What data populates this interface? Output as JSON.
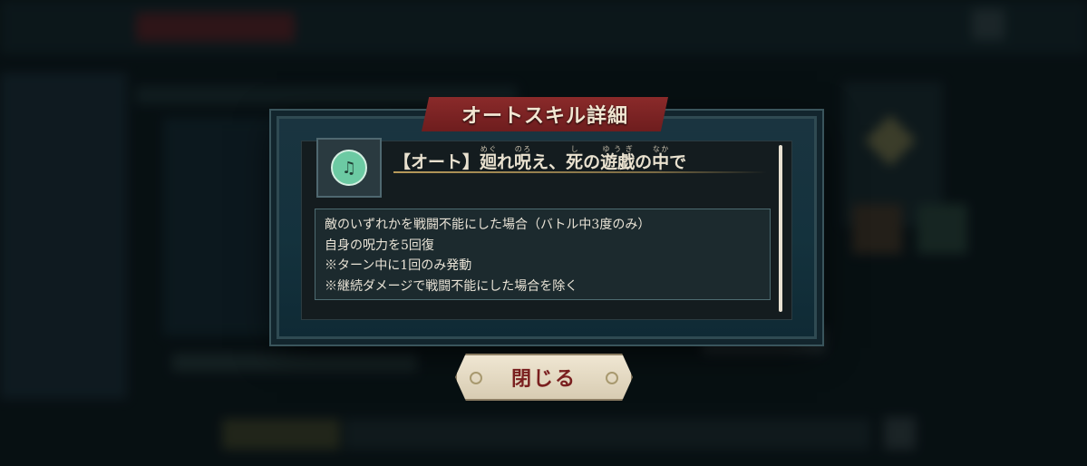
{
  "dialog": {
    "title": "オートスキル詳細",
    "skill": {
      "icon": "skill-emblem-icon",
      "icon_color": "#6ccaa3",
      "name_prefix": "【オート】",
      "name_parts": [
        {
          "base": "廻",
          "ruby": "めぐ"
        },
        {
          "base": "れ",
          "ruby": ""
        },
        {
          "base": "呪",
          "ruby": "のろ"
        },
        {
          "base": "え、",
          "ruby": ""
        },
        {
          "base": "死",
          "ruby": "し"
        },
        {
          "base": "の",
          "ruby": ""
        },
        {
          "base": "遊戯",
          "ruby": "ゆうぎ"
        },
        {
          "base": "の",
          "ruby": ""
        },
        {
          "base": "中",
          "ruby": "なか"
        },
        {
          "base": "で",
          "ruby": ""
        }
      ]
    },
    "description": [
      "敵のいずれかを戦闘不能にした場合（バトル中3度のみ）",
      "自身の呪力を5回復",
      "※ターン中に1回のみ発動",
      "※継続ダメージで戦闘不能にした場合を除く"
    ],
    "close_label": "閉じる"
  },
  "colors": {
    "banner": "#8a2a2a",
    "close_text": "#7a1f1f",
    "panel": "#14323d"
  }
}
